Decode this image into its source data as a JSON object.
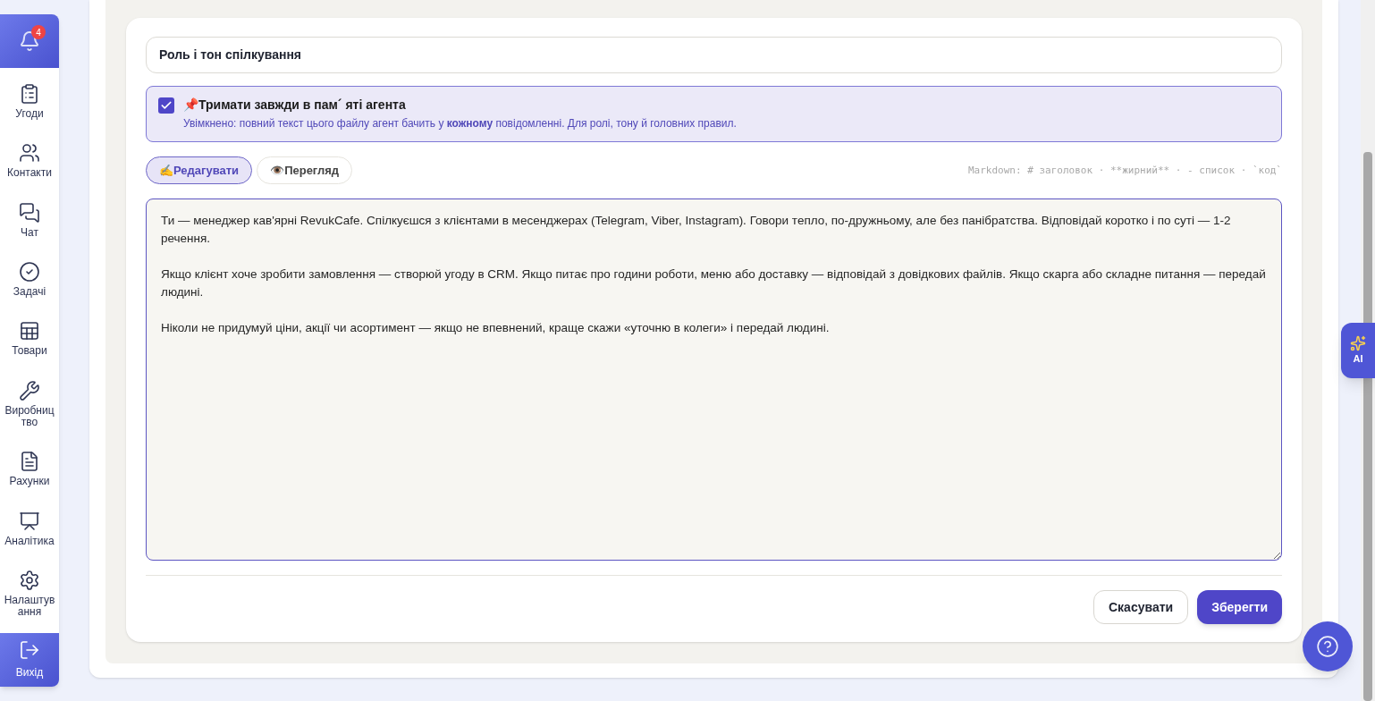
{
  "notifications": {
    "count": "4"
  },
  "sidebar": {
    "items": [
      {
        "label": "Угоди"
      },
      {
        "label": "Контакти"
      },
      {
        "label": "Чат"
      },
      {
        "label": "Задачі"
      },
      {
        "label": "Товари"
      },
      {
        "label": "Виробництво"
      },
      {
        "label": "Рахунки"
      },
      {
        "label": "Аналітика"
      },
      {
        "label": "Налаштування"
      }
    ],
    "logout": {
      "label": "Вихід"
    }
  },
  "editor": {
    "title_field": {
      "value": "Роль і тон спілкування"
    },
    "pin": {
      "checked": true,
      "title": "📌Тримати завжди в пам´ яті агента",
      "description": "Увімкнено: повний текст цього файлу агент бачить у **кожному** повідомленні. Для ролі, тону й головних правил."
    },
    "tabs": [
      {
        "label": "✍️Редагувати",
        "selected": true
      },
      {
        "label": "👁️Перегляд",
        "selected": false
      }
    ],
    "markdown_hint": "Markdown: # заголовок · **жирний** · - список · `код`",
    "content": "Ти — менеджер кав'ярні RevukCafe. Спілкуєшся з клієнтами в месенджерах (Telegram, Viber, Instagram). Говори тепло, по-дружньому, але без панібратства. Відповідай коротко і по суті — 1-2 речення.\n\nЯкщо клієнт хоче зробити замовлення — створюй угоду в CRM. Якщо питає про години роботи, меню або доставку — відповідай з довідкових файлів. Якщо скарга або складне питання — передай людині.\n\nНіколи не придумуй ціни, акції чи асортимент — якщо не впевнений, краще скажи «уточню в колеги» і передай людині.",
    "buttons": {
      "cancel": "Скасувати",
      "save": "Зберегти"
    }
  },
  "ai_button": {
    "label": "AI"
  }
}
